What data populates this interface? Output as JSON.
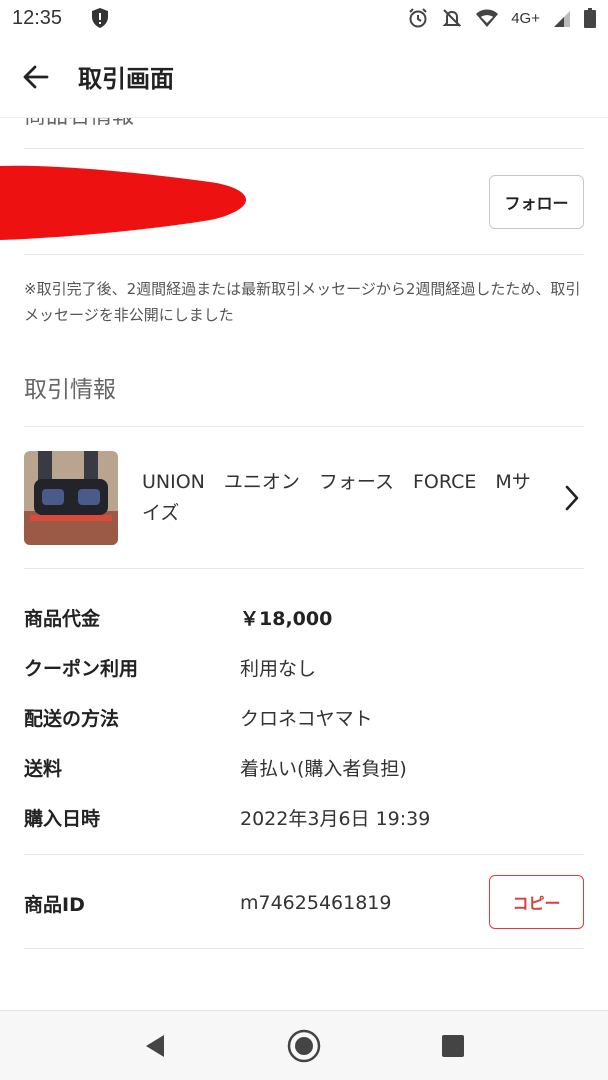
{
  "status_bar": {
    "time": "12:35",
    "network": "4G+",
    "icons": [
      "shield-icon",
      "alarm-icon",
      "mute-icon",
      "wifi-icon",
      "signal-icon",
      "battery-icon"
    ]
  },
  "app_bar": {
    "title": "取引画面",
    "back_icon": "arrow-left-icon"
  },
  "page": {
    "cut_off_heading": "商品名情報",
    "follow_button": "フォロー",
    "notice": "※取引完了後、2週間経過または最新取引メッセージから2週間経過したため、取引メッセージを非公開にしました",
    "section_title": "取引情報",
    "item": {
      "name": "UNION　ユニオン　フォース　FORCE　Mサイズ",
      "chevron_icon": "chevron-right-icon"
    },
    "details": [
      {
        "label": "商品代金",
        "value": "￥18,000"
      },
      {
        "label": "クーポン利用",
        "value": "利用なし"
      },
      {
        "label": "配送の方法",
        "value": "クロネコヤマト"
      },
      {
        "label": "送料",
        "value": "着払い(購入者負担)"
      },
      {
        "label": "購入日時",
        "value": "2022年3月6日 19:39"
      }
    ],
    "product_id": {
      "label": "商品ID",
      "value": "m74625461819",
      "copy_button": "コピー"
    }
  },
  "nav_bar": {
    "icons": [
      "back-triangle-icon",
      "home-circle-icon",
      "recents-square-icon"
    ]
  },
  "colors": {
    "accent_red": "#e03a3a",
    "redaction_red": "#ee1111",
    "divider": "#e6e6e6"
  }
}
